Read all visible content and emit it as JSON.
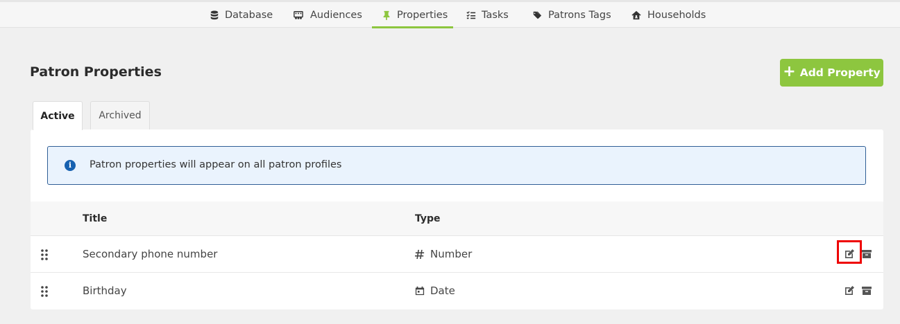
{
  "nav": {
    "items": [
      {
        "label": "Database",
        "icon": "database-icon"
      },
      {
        "label": "Audiences",
        "icon": "audiences-icon"
      },
      {
        "label": "Properties",
        "icon": "pin-icon",
        "active": true
      },
      {
        "label": "Tasks",
        "icon": "tasks-icon"
      },
      {
        "label": "Patrons Tags",
        "icon": "tags-icon"
      },
      {
        "label": "Households",
        "icon": "house-icon"
      }
    ],
    "active_color": "#8dc63f"
  },
  "page": {
    "title": "Patron Properties",
    "add_button_label": "Add Property",
    "accent": "#8dc63f"
  },
  "tabs": {
    "active_label": "Active",
    "archived_label": "Archived"
  },
  "alert": {
    "text": "Patron properties will appear on all patron profiles",
    "icon": "info-icon"
  },
  "table": {
    "columns": [
      "Title",
      "Type"
    ],
    "rows": [
      {
        "title": "Secondary phone number",
        "type": "Number",
        "type_icon": "hash-icon"
      },
      {
        "title": "Birthday",
        "type": "Date",
        "type_icon": "calendar-icon"
      }
    ]
  }
}
